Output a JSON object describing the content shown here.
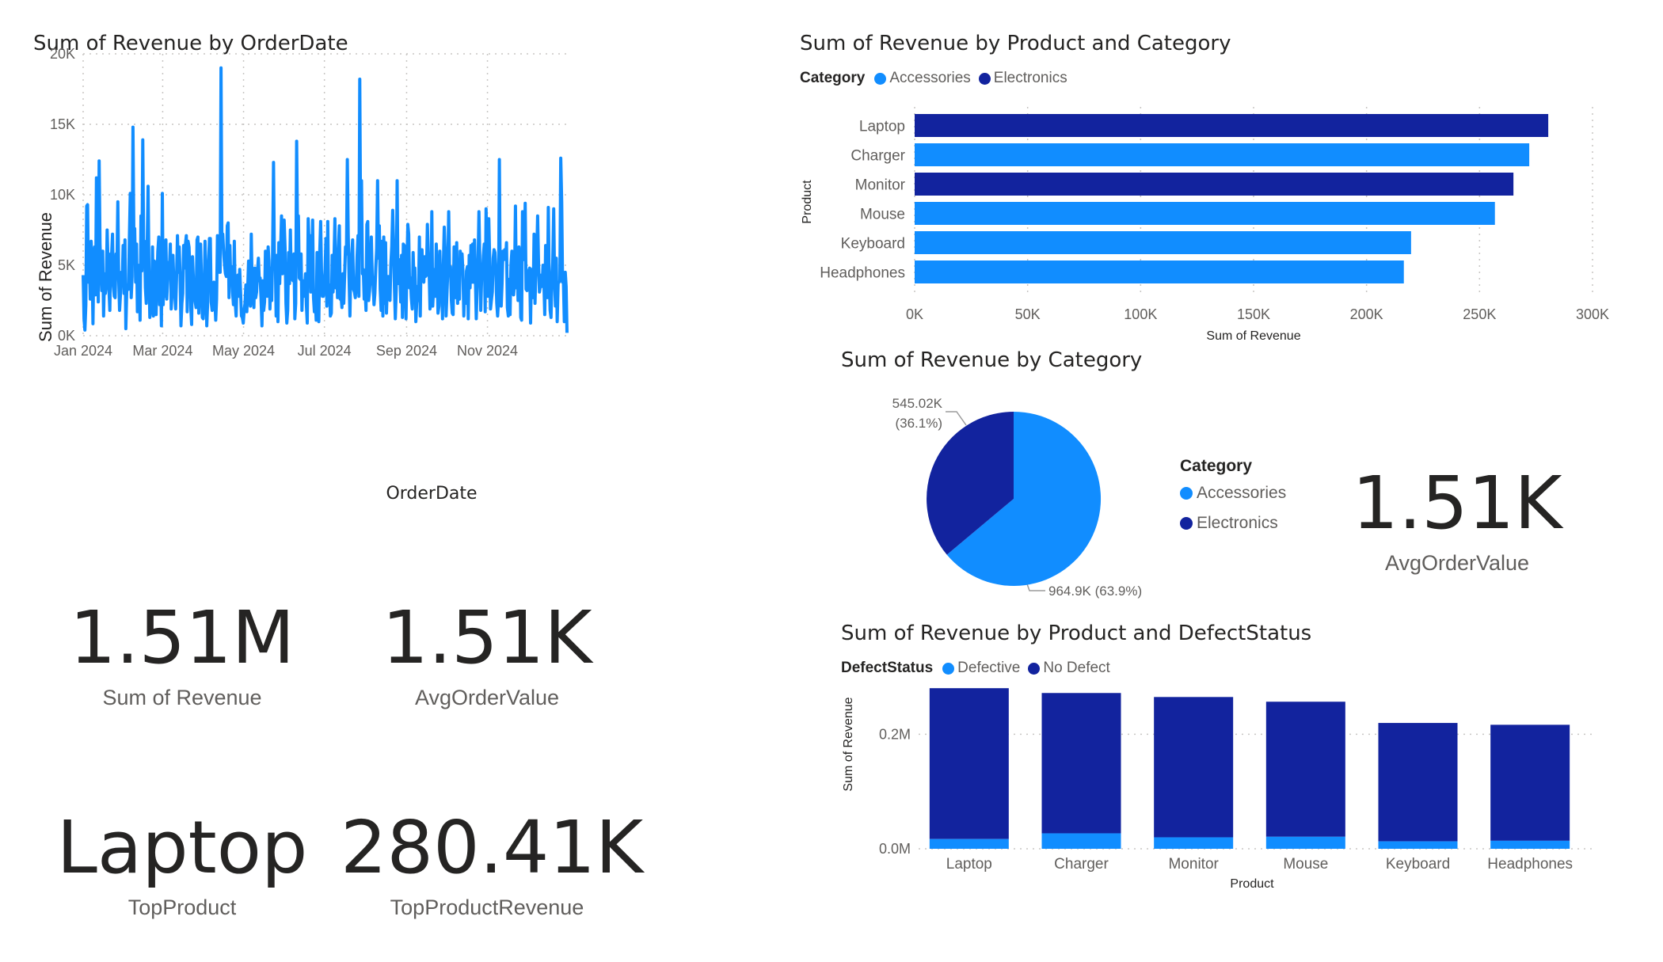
{
  "colors": {
    "accessories": "#118DFF",
    "electronics": "#12239E",
    "line": "#118DFF",
    "grid": "#c8c6c4",
    "axis_text": "#605e5c"
  },
  "kpis": {
    "revenue": {
      "value": "1.51M",
      "label": "Sum of Revenue"
    },
    "aov_left": {
      "value": "1.51K",
      "label": "AvgOrderValue"
    },
    "top_product": {
      "value": "Laptop",
      "label": "TopProduct"
    },
    "top_product_revenue": {
      "value": "280.41K",
      "label": "TopProductRevenue"
    },
    "aov_right": {
      "value": "1.51K",
      "label": "AvgOrderValue"
    }
  },
  "line_chart": {
    "title": "Sum of Revenue by OrderDate"
  },
  "bar_chart": {
    "title": "Sum of Revenue by Product and Category",
    "legend_title": "Category"
  },
  "pie_chart": {
    "title": "Sum of Revenue by Category",
    "legend_title": "Category"
  },
  "col_chart": {
    "title": "Sum of Revenue by Product and DefectStatus",
    "legend_title": "DefectStatus"
  },
  "chart_data": [
    {
      "type": "line",
      "title": "Sum of Revenue by OrderDate",
      "xlabel": "OrderDate",
      "ylabel": "Sum of Revenue",
      "x_tick_labels": [
        "Jan 2024",
        "Mar 2024",
        "May 2024",
        "Jul 2024",
        "Sep 2024",
        "Nov 2024"
      ],
      "y_tick_labels": [
        "0K",
        "5K",
        "10K",
        "15K",
        "20K"
      ],
      "ylim": [
        0,
        20000
      ],
      "grid": true,
      "x_start": "2024-01-01",
      "x_end": "2024-12-31",
      "series": [
        {
          "values": [
            4300,
            1200,
            400,
            2200,
            9200,
            9300,
            3800,
            5000,
            2600,
            6700,
            5400,
            850,
            5500,
            6300,
            2900,
            11200,
            8300,
            2400,
            12400,
            6500,
            4500,
            3200,
            6000,
            1400,
            4400,
            3000,
            3600,
            7500,
            5200,
            3300,
            1800,
            5800,
            5700,
            7200,
            3500,
            2800,
            2700,
            5800,
            5100,
            9500,
            4000,
            1800,
            3000,
            4500,
            3900,
            6400,
            3000,
            6800,
            500,
            3100,
            3600,
            3300,
            7000,
            10100,
            2700,
            4200,
            14800,
            7200,
            7600,
            3800,
            6500,
            1700,
            5000,
            4100,
            1100,
            8500,
            4600,
            13900,
            6100,
            6700,
            3400,
            2300,
            6500,
            10600,
            4700,
            1300,
            1900,
            2200,
            6300,
            1400,
            5300,
            4900,
            1500,
            3900,
            6000,
            7000,
            2200,
            5600,
            700,
            10100,
            2200,
            6400,
            2800,
            6800,
            2600,
            4000,
            5200,
            4700,
            6500,
            1900,
            3000,
            5700,
            3700,
            3000,
            1900,
            4000,
            7100,
            4500,
            6300,
            4300,
            700,
            2300,
            3000,
            6400,
            4800,
            6500,
            7100,
            1700,
            6700,
            6300,
            4700,
            2000,
            800,
            5600,
            3900,
            2900,
            2400,
            2000,
            6800,
            7000,
            1600,
            3900,
            6500,
            4100,
            1300,
            1200,
            2800,
            6700,
            4100,
            700,
            2300,
            5200,
            6900,
            6900,
            2400,
            1800,
            2900,
            3800,
            2700,
            1100,
            2600,
            7100,
            6000,
            4500,
            4500,
            19000,
            6400,
            7200,
            5800,
            5000,
            4400,
            4200,
            7800,
            8000,
            2700,
            6400,
            3800,
            4900,
            3100,
            2200,
            6700,
            2300,
            1400,
            3900,
            4300,
            2800,
            4700,
            3100,
            1400,
            1300,
            900,
            1800,
            2300,
            3600,
            1700,
            3400,
            5300,
            2700,
            2100,
            7200,
            3500,
            2700,
            2000,
            4800,
            2700,
            3100,
            4500,
            5500,
            3900,
            4100,
            2700,
            700,
            3900,
            1800,
            2400,
            6000,
            3100,
            2800,
            6300,
            5300,
            1900,
            4800,
            2500,
            5600,
            12300,
            5200,
            5700,
            1400,
            5700,
            1000,
            6600,
            3700,
            6000,
            8500,
            4400,
            6800,
            8200,
            6200,
            2300,
            900,
            1800,
            5900,
            3700,
            7500,
            4000,
            4900,
            3900,
            5800,
            1200,
            2300,
            13800,
            7200,
            8500,
            4100,
            4000,
            5800,
            1800,
            3900,
            2800,
            3300,
            4400,
            2200,
            900,
            8300,
            6400,
            7100,
            3100,
            4000,
            8200,
            2700,
            1700,
            2700,
            1100,
            5900,
            4200,
            1000,
            6000,
            8100,
            4500,
            2800,
            2800,
            3500,
            4700,
            6900,
            2100,
            8100,
            2500,
            3600,
            1400,
            1600,
            5700,
            3100,
            5200,
            8300,
            3400,
            5800,
            2700,
            6100,
            7800,
            2600,
            2800,
            2000,
            4400,
            2300,
            4300,
            6300,
            5800,
            12500,
            7300,
            4100,
            1400,
            5200,
            5800,
            6800,
            3300,
            3100,
            2700,
            3500,
            5600,
            7100,
            2800,
            18200,
            7300,
            11000,
            4400,
            4700,
            2600,
            3300,
            1800,
            7900,
            8100,
            2500,
            3200,
            4500,
            7000,
            4300,
            3500,
            2200,
            3000,
            4800,
            6100,
            11000,
            5500,
            7800,
            3300,
            1800,
            6700,
            1400,
            7000,
            2300,
            6600,
            1600,
            3600,
            4200,
            2700,
            2500,
            5100,
            6300,
            8900,
            6600,
            3400,
            1200,
            3300,
            11000,
            3700,
            5400,
            4900,
            2400,
            5700,
            1300,
            6500,
            6400,
            3600,
            1200,
            4800,
            7900,
            7200,
            3400,
            4100,
            2700,
            1900,
            5900,
            3800,
            4800,
            1000,
            2300,
            3500,
            2500,
            7000,
            1400,
            5900,
            6100,
            4000,
            3800,
            5600,
            4200,
            4300,
            7900,
            5700,
            4600,
            1900,
            3100,
            8800,
            2100,
            3300,
            4700,
            2800,
            6500,
            4500,
            1600,
            2100,
            6000,
            3800,
            4400,
            1200,
            5100,
            7700,
            6000,
            1400,
            3000,
            4600,
            8800,
            4500,
            4900,
            2500,
            1600,
            1500,
            6300,
            5100,
            2700,
            6600,
            2300,
            4800,
            2600,
            6000,
            4500,
            5800,
            4500,
            1400,
            3500,
            2300,
            4600,
            4900,
            1200,
            5700,
            3400,
            6400,
            3800,
            6500,
            3800,
            6800,
            4200,
            1200,
            3600,
            5200,
            8800,
            5400,
            1800,
            4100,
            4200,
            5700,
            6500,
            1700,
            9000,
            5900,
            2800,
            8300,
            5600,
            1900,
            2500,
            3100,
            5500,
            6100,
            5900,
            4700,
            2300,
            1400,
            2500,
            12500,
            2500,
            2100,
            3700,
            6000,
            5400,
            6100,
            5500,
            6600,
            2000,
            1400,
            4000,
            1500,
            5000,
            6000,
            3300,
            2900,
            3800,
            9200,
            3400,
            5000,
            2500,
            6300,
            5200,
            1300,
            1100,
            8800,
            6500,
            5400,
            9400,
            3300,
            3200,
            3700,
            4600,
            4800,
            900,
            4700,
            3500,
            2700,
            7200,
            2300,
            4700,
            5700,
            8500,
            5000,
            3100,
            3500,
            4300,
            3500,
            5000,
            3800,
            1500,
            6400,
            5900,
            2700,
            9100,
            4200,
            1800,
            1300,
            3900,
            5200,
            9000,
            3900,
            2100,
            5500,
            1000,
            3700,
            3800,
            3900,
            12600,
            9500,
            3800,
            3900,
            1000,
            4500,
            3500,
            200
          ]
        }
      ]
    },
    {
      "type": "bar",
      "orientation": "horizontal",
      "title": "Sum of Revenue by Product and Category",
      "xlabel": "Sum of Revenue",
      "ylabel": "Product",
      "categories": [
        "Laptop",
        "Charger",
        "Monitor",
        "Mouse",
        "Keyboard",
        "Headphones"
      ],
      "values": [
        280410,
        272000,
        265000,
        256800,
        219700,
        216500
      ],
      "category_of_bar": [
        "Electronics",
        "Accessories",
        "Electronics",
        "Accessories",
        "Accessories",
        "Accessories"
      ],
      "legend": [
        "Accessories",
        "Electronics"
      ],
      "legend_position": "top-left",
      "x_tick_labels": [
        "0K",
        "50K",
        "100K",
        "150K",
        "200K",
        "250K",
        "300K"
      ],
      "xlim": [
        0,
        300000
      ],
      "grid": true
    },
    {
      "type": "pie",
      "title": "Sum of Revenue by Category",
      "slices": [
        {
          "label": "Accessories",
          "value": 964900,
          "display": "964.9K (63.9%)"
        },
        {
          "label": "Electronics",
          "value": 545020,
          "display": "545.02K",
          "percent_display": "(36.1%)"
        }
      ],
      "legend_title": "Category",
      "legend_position": "right"
    },
    {
      "type": "bar",
      "orientation": "vertical",
      "stacked": true,
      "title": "Sum of Revenue by Product and DefectStatus",
      "xlabel": "Product",
      "ylabel": "Sum of Revenue",
      "categories": [
        "Laptop",
        "Charger",
        "Monitor",
        "Mouse",
        "Keyboard",
        "Headphones"
      ],
      "series": [
        {
          "name": "Defective",
          "values": [
            17000,
            27000,
            20000,
            21000,
            13000,
            14000
          ]
        },
        {
          "name": "No Defect",
          "values": [
            263410,
            245000,
            245000,
            235800,
            206700,
            202500
          ]
        }
      ],
      "y_tick_labels": [
        "0.0M",
        "0.2M"
      ],
      "ylim": [
        0,
        300000
      ],
      "legend_position": "top-left",
      "grid": true
    }
  ]
}
